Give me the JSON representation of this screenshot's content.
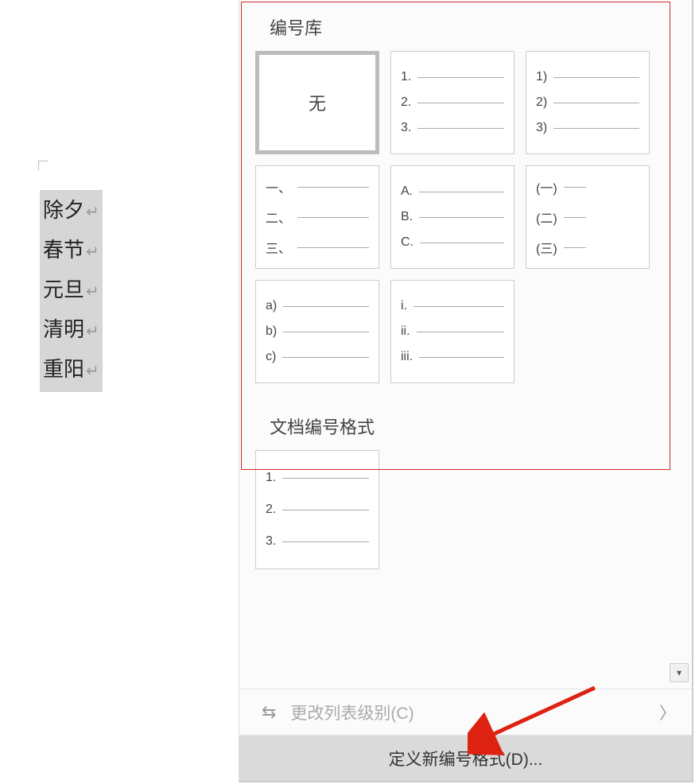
{
  "document": {
    "lines": [
      "除夕",
      "春节",
      "元旦",
      "清明",
      "重阳"
    ]
  },
  "dropdown": {
    "library_title": "编号库",
    "doc_formats_title": "文档编号格式",
    "none_label": "无",
    "tiles": {
      "arabic_period": [
        "1.",
        "2.",
        "3."
      ],
      "arabic_paren": [
        "1)",
        "2)",
        "3)"
      ],
      "chinese_comma": [
        "一、",
        "二、",
        "三、"
      ],
      "upper_alpha": [
        "A.",
        "B.",
        "C."
      ],
      "chinese_paren": [
        "(一)",
        "(二)",
        "(三)"
      ],
      "lower_alpha_paren": [
        "a)",
        "b)",
        "c)"
      ],
      "roman_lower": [
        "i.",
        "ii.",
        "iii."
      ]
    },
    "doc_format_tile": [
      "1.",
      "2.",
      "3."
    ],
    "change_level_label": "更改列表级别(C)",
    "define_new_label": "定义新编号格式(D)..."
  }
}
